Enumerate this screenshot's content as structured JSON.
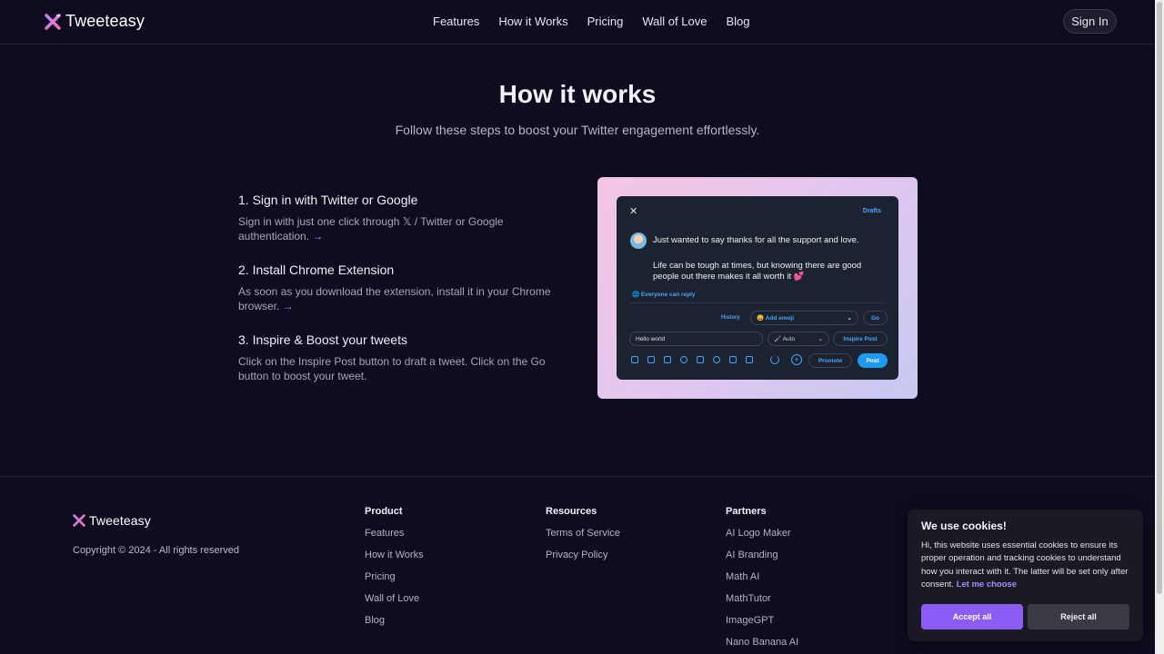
{
  "nav": {
    "brand": "Tweeteasy",
    "links": [
      "Features",
      "How it Works",
      "Pricing",
      "Wall of Love",
      "Blog"
    ],
    "signin": "Sign In"
  },
  "hero": {
    "title": "How it works",
    "subtitle": "Follow these steps to boost your Twitter engagement effortlessly."
  },
  "steps": [
    {
      "title": "1. Sign in with Twitter or Google",
      "text": "Sign in with just one click through 𝕏 / Twitter or Google authentication.",
      "arrow": "→"
    },
    {
      "title": "2. Install Chrome Extension",
      "text": "As soon as you download the extension, install it in your Chrome browser.",
      "arrow": "→"
    },
    {
      "title": "3. Inspire & Boost your tweets",
      "text": "Click on the Inspire Post button to draft a tweet. Click on the Go button to boost your tweet."
    }
  ],
  "preview": {
    "close": "✕",
    "drafts": "Drafts",
    "line1": "Just wanted to say thanks for all the support and love.",
    "line2": "Life can be tough at times, but knowing there are good people out there makes it all worth it 💕",
    "reply": "🌐 Everyone can reply",
    "history": "History",
    "emoji": "😀 Add emoji",
    "go": "Go",
    "input_value": "Hello world",
    "auto": "🖌 Auto",
    "inspire": "Inspire Post",
    "promote": "Promote",
    "post": "Post"
  },
  "footer": {
    "brand": "Tweeteasy",
    "copyright": "Copyright © 2024 - All rights reserved",
    "product": {
      "heading": "Product",
      "items": [
        "Features",
        "How it Works",
        "Pricing",
        "Wall of Love",
        "Blog"
      ]
    },
    "resources": {
      "heading": "Resources",
      "items": [
        "Terms of Service",
        "Privacy Policy"
      ]
    },
    "partners": {
      "heading": "Partners",
      "items": [
        "AI Logo Maker",
        "AI Branding",
        "Math AI",
        "MathTutor",
        "ImageGPT",
        "Nano Banana AI"
      ]
    }
  },
  "cookie": {
    "title": "We use cookies!",
    "text": "Hi, this website uses essential cookies to ensure its proper operation and tracking cookies to understand how you interact with it. The latter will be set only after consent.",
    "link": "Let me choose",
    "accept": "Accept all",
    "reject": "Reject all"
  },
  "colors": {
    "background": "#0f0c1f",
    "accent": "#8b5cf6",
    "twitter_blue": "#1d9bf0"
  }
}
